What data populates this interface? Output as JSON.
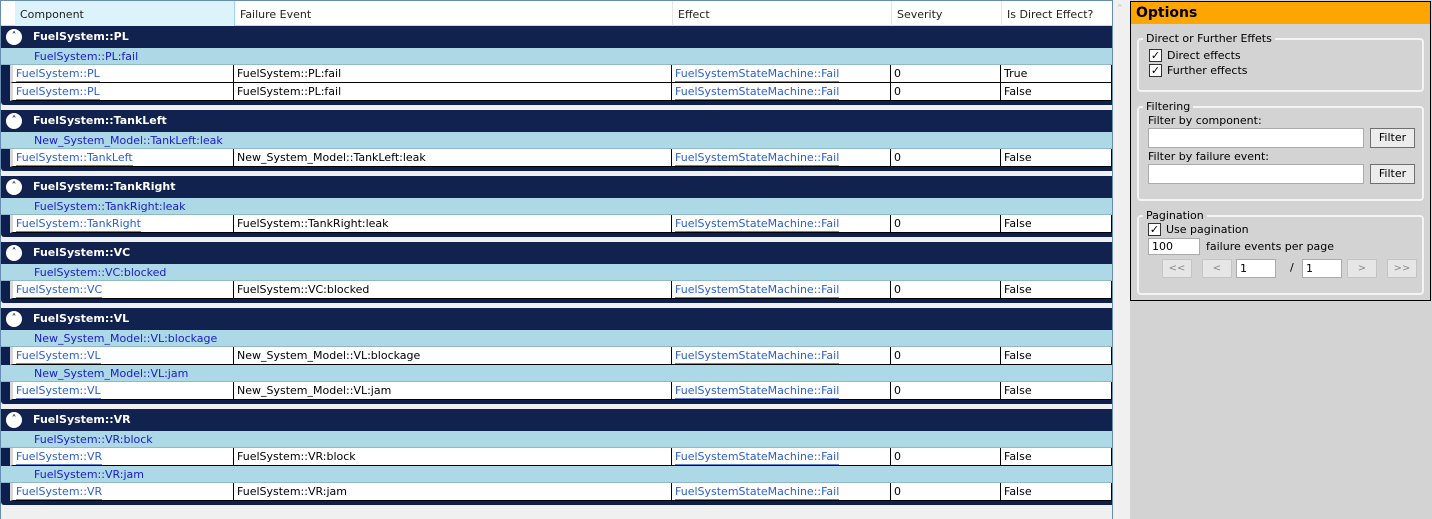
{
  "grid": {
    "columns": [
      "Component",
      "Failure Event",
      "Effect",
      "Severity",
      "Is Direct Effect?"
    ],
    "groups": [
      {
        "title": "FuelSystem::PL",
        "subgroups": [
          {
            "title": "FuelSystem::PL:fail",
            "rows": [
              {
                "component": "FuelSystem::PL",
                "failure_event": "FuelSystem::PL:fail",
                "effect": "FuelSystemStateMachine::Fail",
                "severity": "0",
                "is_direct": "True"
              },
              {
                "component": "FuelSystem::PL",
                "failure_event": "FuelSystem::PL:fail",
                "effect": "FuelSystemStateMachine::Fail",
                "severity": "0",
                "is_direct": "False"
              }
            ]
          }
        ]
      },
      {
        "title": "FuelSystem::TankLeft",
        "subgroups": [
          {
            "title": "New_System_Model::TankLeft:leak",
            "rows": [
              {
                "component": "FuelSystem::TankLeft",
                "failure_event": "New_System_Model::TankLeft:leak",
                "effect": "FuelSystemStateMachine::Fail",
                "severity": "0",
                "is_direct": "False"
              }
            ]
          }
        ]
      },
      {
        "title": "FuelSystem::TankRight",
        "subgroups": [
          {
            "title": "FuelSystem::TankRight:leak",
            "rows": [
              {
                "component": "FuelSystem::TankRight",
                "failure_event": "FuelSystem::TankRight:leak",
                "effect": "FuelSystemStateMachine::Fail",
                "severity": "0",
                "is_direct": "False"
              }
            ]
          }
        ]
      },
      {
        "title": "FuelSystem::VC",
        "subgroups": [
          {
            "title": "FuelSystem::VC:blocked",
            "rows": [
              {
                "component": "FuelSystem::VC",
                "failure_event": "FuelSystem::VC:blocked",
                "effect": "FuelSystemStateMachine::Fail",
                "severity": "0",
                "is_direct": "False"
              }
            ]
          }
        ]
      },
      {
        "title": "FuelSystem::VL",
        "subgroups": [
          {
            "title": "New_System_Model::VL:blockage",
            "rows": [
              {
                "component": "FuelSystem::VL",
                "failure_event": "New_System_Model::VL:blockage",
                "effect": "FuelSystemStateMachine::Fail",
                "severity": "0",
                "is_direct": "False"
              }
            ]
          },
          {
            "title": "New_System_Model::VL:jam",
            "rows": [
              {
                "component": "FuelSystem::VL",
                "failure_event": "New_System_Model::VL:jam",
                "effect": "FuelSystemStateMachine::Fail",
                "severity": "0",
                "is_direct": "False"
              }
            ]
          }
        ]
      },
      {
        "title": "FuelSystem::VR",
        "subgroups": [
          {
            "title": "FuelSystem::VR:block",
            "rows": [
              {
                "component": "FuelSystem::VR",
                "failure_event": "FuelSystem::VR:block",
                "effect": "FuelSystemStateMachine::Fail",
                "severity": "0",
                "is_direct": "False"
              }
            ]
          },
          {
            "title": "FuelSystem::VR:jam",
            "rows": [
              {
                "component": "FuelSystem::VR",
                "failure_event": "FuelSystem::VR:jam",
                "effect": "FuelSystemStateMachine::Fail",
                "severity": "0",
                "is_direct": "False"
              }
            ]
          }
        ]
      }
    ]
  },
  "icons": {
    "collapse": "chevron-up-icon",
    "scroll_up": "scroll-up-arrow-icon",
    "checkbox_checked": "checkmark-icon"
  },
  "colors": {
    "group_header": "#12224f",
    "subgroup": "#add8e6",
    "options_header": "#ffa500",
    "link": "#2a5fcf"
  },
  "options": {
    "title": "Options",
    "effects_group": {
      "legend": "Direct or Further Effets",
      "direct_label": "Direct effects",
      "direct_checked": true,
      "further_label": "Further effects",
      "further_checked": true
    },
    "filtering_group": {
      "legend": "Filtering",
      "component_label": "Filter by component:",
      "component_value": "",
      "component_button": "Filter",
      "event_label": "Filter by failure event:",
      "event_value": "",
      "event_button": "Filter"
    },
    "pagination_group": {
      "legend": "Pagination",
      "use_label": "Use pagination",
      "use_checked": true,
      "per_page_value": "100",
      "per_page_label": "failure events per page",
      "first_label": "<<",
      "prev_label": "<",
      "current_page": "1",
      "separator": "/",
      "total_pages": "1",
      "next_label": ">",
      "last_label": ">>"
    }
  }
}
